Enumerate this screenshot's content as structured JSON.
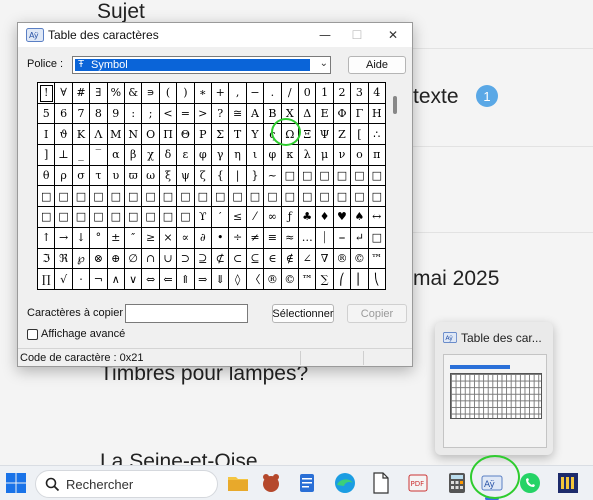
{
  "background": {
    "texts": [
      "Sujet",
      "texte",
      "mai 2025",
      "Timbres pour lampes?",
      "La Seine-et-Oise"
    ],
    "badge": "1"
  },
  "dialog": {
    "title": "Table des caractères",
    "font_label": "Police :",
    "font_value": "Symbol",
    "help_button": "Aide",
    "grid_rows": [
      [
        "!",
        "∀",
        "#",
        "∃",
        "%",
        "&",
        "∍",
        "(",
        ")",
        "∗",
        "+",
        ",",
        "−",
        ".",
        "/",
        "0",
        "1",
        "2",
        "3",
        "4"
      ],
      [
        "5",
        "6",
        "7",
        "8",
        "9",
        ":",
        ";",
        "<",
        "=",
        ">",
        "?",
        "≅",
        "Α",
        "Β",
        "Χ",
        "Δ",
        "Ε",
        "Φ",
        "Γ",
        "Η"
      ],
      [
        "Ι",
        "ϑ",
        "Κ",
        "Λ",
        "Μ",
        "Ν",
        "Ο",
        "Π",
        "Θ",
        "Ρ",
        "Σ",
        "Τ",
        "Υ",
        "ς",
        "Ω",
        "Ξ",
        "Ψ",
        "Ζ",
        "[",
        "∴"
      ],
      [
        "]",
        "⊥",
        "_",
        "‾",
        "α",
        "β",
        "χ",
        "δ",
        "ε",
        "φ",
        "γ",
        "η",
        "ι",
        "φ",
        "κ",
        "λ",
        "μ",
        "ν",
        "ο",
        "π"
      ],
      [
        "θ",
        "ρ",
        "σ",
        "τ",
        "υ",
        "ϖ",
        "ω",
        "ξ",
        "ψ",
        "ζ",
        "{",
        "|",
        "}",
        "~",
        "□",
        "□",
        "□",
        "□",
        "□",
        "□"
      ],
      [
        "□",
        "□",
        "□",
        "□",
        "□",
        "□",
        "□",
        "□",
        "□",
        "□",
        "□",
        "□",
        "□",
        "□",
        "□",
        "□",
        "□",
        "□",
        "□",
        "□"
      ],
      [
        "□",
        "□",
        "□",
        "□",
        "□",
        "□",
        "□",
        "□",
        "□",
        "ϒ",
        "′",
        "≤",
        "⁄",
        "∞",
        "ƒ",
        "♣",
        "♦",
        "♥",
        "♠",
        "↔"
      ],
      [
        "↑",
        "→",
        "↓",
        "°",
        "±",
        "″",
        "≥",
        "×",
        "∝",
        "∂",
        "•",
        "÷",
        "≠",
        "≡",
        "≈",
        "…",
        "⏐",
        "⎯",
        "↵",
        "□"
      ],
      [
        "ℑ",
        "ℜ",
        "℘",
        "⊗",
        "⊕",
        "∅",
        "∩",
        "∪",
        "⊃",
        "⊇",
        "⊄",
        "⊂",
        "⊆",
        "∈",
        "∉",
        "∠",
        "∇",
        "®",
        "©",
        "™"
      ],
      [
        "∏",
        "√",
        "⋅",
        "¬",
        "∧",
        "∨",
        "⇔",
        "⇐",
        "⇑",
        "⇒",
        "⇓",
        "◊",
        "〈",
        "®",
        "©",
        "™",
        "∑",
        "⎛",
        "⎜",
        "⎝"
      ]
    ],
    "selected_char": "!",
    "copy_label": "Caractères à copier :",
    "copy_value": "",
    "select_button": "Sélectionner",
    "copy_button": "Copier",
    "advanced_label": "Affichage avancé",
    "advanced_checked": false,
    "status_text": "Code de caractère : 0x21"
  },
  "thumbnail": {
    "title": "Table des car..."
  },
  "taskbar": {
    "search_placeholder": "Rechercher",
    "icons": [
      "windows-start-icon",
      "search-icon",
      "file-explorer-icon",
      "game-icon",
      "notepad-icon",
      "edge-icon",
      "document-icon",
      "pdf-tool-icon",
      "calculator-icon",
      "character-map-icon",
      "whatsapp-icon",
      "app-icon"
    ],
    "accent": "#3a6ee8"
  },
  "annotations": {
    "ring_color": "#2ecc2e"
  }
}
